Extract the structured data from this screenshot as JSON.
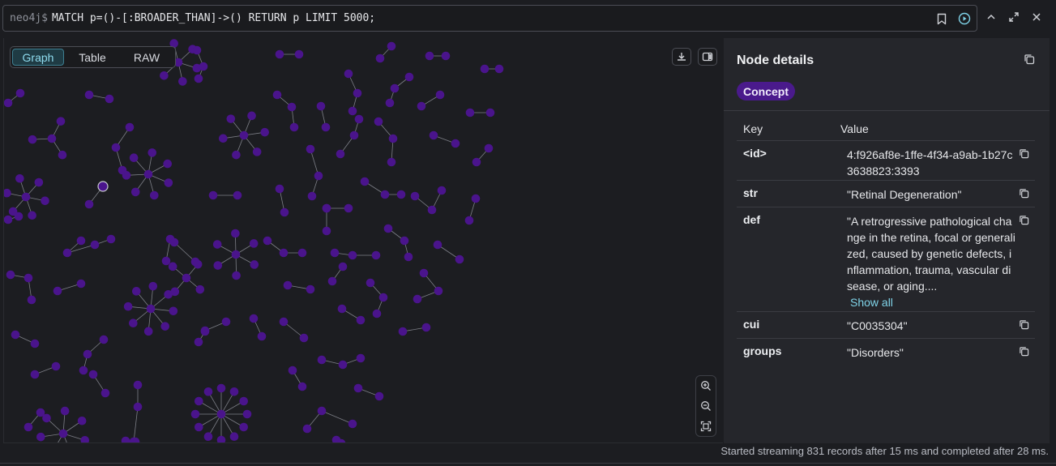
{
  "editor": {
    "prompt": "neo4j$",
    "query": "MATCH p=()-[:BROADER_THAN]->() RETURN p LIMIT 5000;",
    "icons": [
      "bookmark-icon",
      "run-icon"
    ]
  },
  "window_controls": [
    "collapse-icon",
    "fullscreen-icon",
    "close-icon"
  ],
  "view_tabs": [
    {
      "label": "Graph",
      "active": true
    },
    {
      "label": "Table",
      "active": false
    },
    {
      "label": "RAW",
      "active": false
    }
  ],
  "graph_controls": [
    "download-icon",
    "toggle-panel-icon",
    "zoom-in-icon",
    "zoom-out-icon",
    "fit-icon"
  ],
  "node_details": {
    "title": "Node details",
    "label_chip": "Concept",
    "table_headers": {
      "key": "Key",
      "value": "Value"
    },
    "properties": [
      {
        "key": "<id>",
        "value": "4:f926af8e-1ffe-4f34-a9ab-1b27c3638823:3393"
      },
      {
        "key": "str",
        "value": "\"Retinal Degeneration\""
      },
      {
        "key": "def",
        "value": "\"A retrogressive pathological change in the retina, focal or generalized, caused by genetic defects, inflammation, trauma, vascular disease, or aging....",
        "show_all": "Show all"
      },
      {
        "key": "cui",
        "value": "\"C0035304\""
      },
      {
        "key": "groups",
        "value": "\"Disorders\""
      }
    ]
  },
  "status": "Started streaming 831 records after 15 ms and completed after 28 ms.",
  "colors": {
    "node": "#4a148c",
    "edge": "#7d7f87",
    "accent": "#7fd3e8",
    "chip": "#4a1a8c"
  }
}
